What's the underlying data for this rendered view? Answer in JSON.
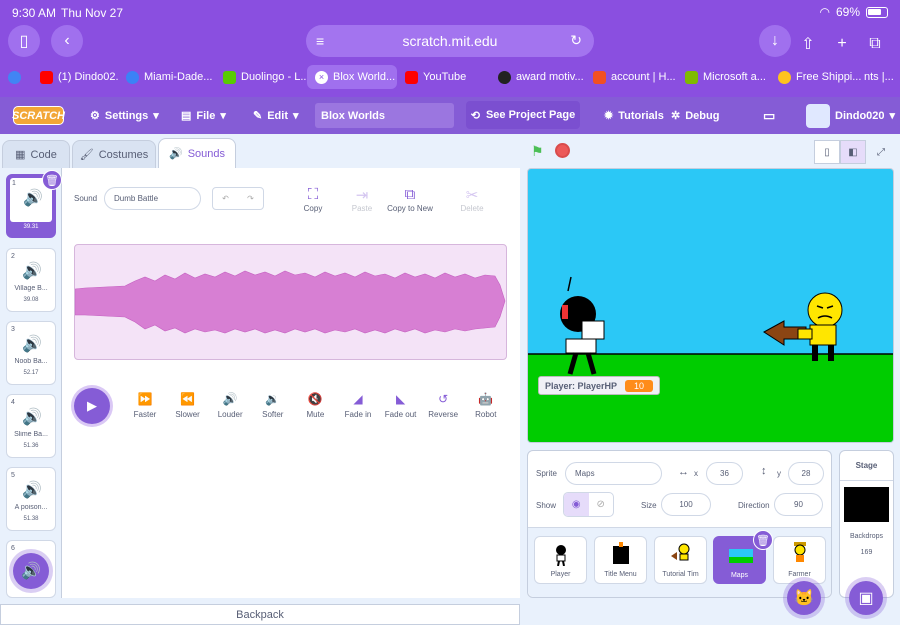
{
  "status": {
    "time": "9:30 AM",
    "date": "Thu Nov 27",
    "battery": "69%"
  },
  "browser": {
    "url": "scratch.mit.edu",
    "tabs": [
      {
        "label": "(1) Dindo02...",
        "color": "#ff0000"
      },
      {
        "label": "Miami-Dade...",
        "color": "#3b82f6"
      },
      {
        "label": "Duolingo - L...",
        "color": "#58cc02"
      },
      {
        "label": "Blox World...",
        "color": "#ffffff",
        "active": true
      },
      {
        "label": "YouTube",
        "color": "#ff0000"
      },
      {
        "label": "award motiv...",
        "color": "#222222"
      },
      {
        "label": "account | H...",
        "color": "#f25022"
      },
      {
        "label": "Microsoft a...",
        "color": "#7fba00"
      },
      {
        "label": "Free Shippi...",
        "color": "#ffc220"
      },
      {
        "label": "nts |...",
        "color": "#7a4dd6"
      }
    ]
  },
  "menu": {
    "logo": "SCRATCH",
    "settings": "Settings",
    "file": "File",
    "edit": "Edit",
    "project_title": "Blox Worlds",
    "see_project": "See Project Page",
    "tutorials": "Tutorials",
    "debug": "Debug",
    "username": "Dindo020"
  },
  "editor_tabs": {
    "code": "Code",
    "costumes": "Costumes",
    "sounds": "Sounds"
  },
  "sounds": [
    {
      "num": "1",
      "name": "Dumb B...",
      "length": "39.31"
    },
    {
      "num": "2",
      "name": "Village B...",
      "length": "39.08"
    },
    {
      "num": "3",
      "name": "Noob Ba...",
      "length": "52.17"
    },
    {
      "num": "4",
      "name": "Slime Ba...",
      "length": "51.36"
    },
    {
      "num": "5",
      "name": "A poison...",
      "length": "51.38"
    },
    {
      "num": "6",
      "name": "",
      "length": ""
    }
  ],
  "sound_editor": {
    "sound_label": "Sound",
    "sound_name": "Dumb Battle",
    "tools": {
      "copy": "Copy",
      "paste": "Paste",
      "copy_new": "Copy to New",
      "delete": "Delete"
    },
    "effects": [
      "Faster",
      "Slower",
      "Louder",
      "Softer",
      "Mute",
      "Fade in",
      "Fade out",
      "Reverse",
      "Robot"
    ]
  },
  "backpack": "Backpack",
  "stage": {
    "monitor_label": "Player: PlayerHP",
    "monitor_value": "10"
  },
  "sprite_info": {
    "sprite_label": "Sprite",
    "sprite_name": "Maps",
    "x_label": "x",
    "x": "36",
    "y_label": "y",
    "y": "28",
    "show_label": "Show",
    "size_label": "Size",
    "size": "100",
    "direction_label": "Direction",
    "direction": "90"
  },
  "sprites": [
    "Player",
    "Title Menu",
    "Tutorial Tim",
    "Maps",
    "Farmer"
  ],
  "stage_panel": {
    "title": "Stage",
    "backdrops_label": "Backdrops",
    "backdrops_count": "169"
  },
  "colors": {
    "accent": "#855cd6",
    "browser": "#8a4fe0",
    "stage_sky": "#2bc8f6",
    "ground": "#00cc00"
  }
}
